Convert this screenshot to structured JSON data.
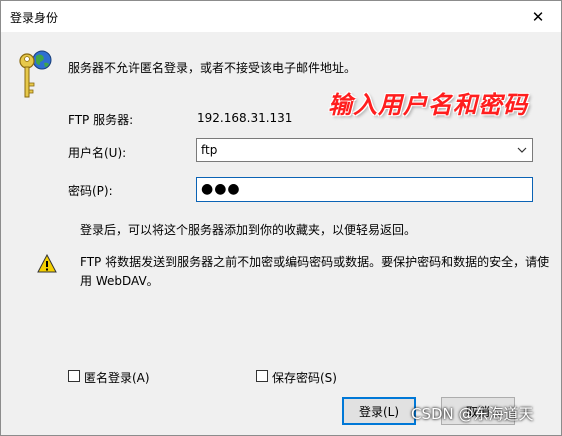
{
  "window": {
    "title": "登录身份"
  },
  "icons": {
    "close": "close-icon",
    "key": "key-globe-icon",
    "warning": "warning-icon",
    "dropdown": "chevron-down-icon"
  },
  "header": {
    "message": "服务器不允许匿名登录，或者不接受该电子邮件地址。"
  },
  "annotation": {
    "text": "输入用户名和密码",
    "color": "#ff1e1e"
  },
  "form": {
    "server_label": "FTP 服务器:",
    "server_value": "192.168.31.131",
    "user_label": "用户名(U):",
    "user_value": "ftp",
    "password_label": "密码(P):",
    "password_value": "●●●"
  },
  "info": {
    "favorites_note": "登录后，可以将这个服务器添加到你的收藏夹，以便轻易返回。",
    "warning_text": "FTP 将数据发送到服务器之前不加密或编码密码或数据。要保护密码和数据的安全，请使用 WebDAV。"
  },
  "options": {
    "anonymous_label": "匿名登录(A)",
    "anonymous_checked": false,
    "save_password_label": "保存密码(S)",
    "save_password_checked": false
  },
  "buttons": {
    "login": "登录(L)",
    "cancel": "取消"
  },
  "watermark": {
    "text": "CSDN @东海道天"
  }
}
